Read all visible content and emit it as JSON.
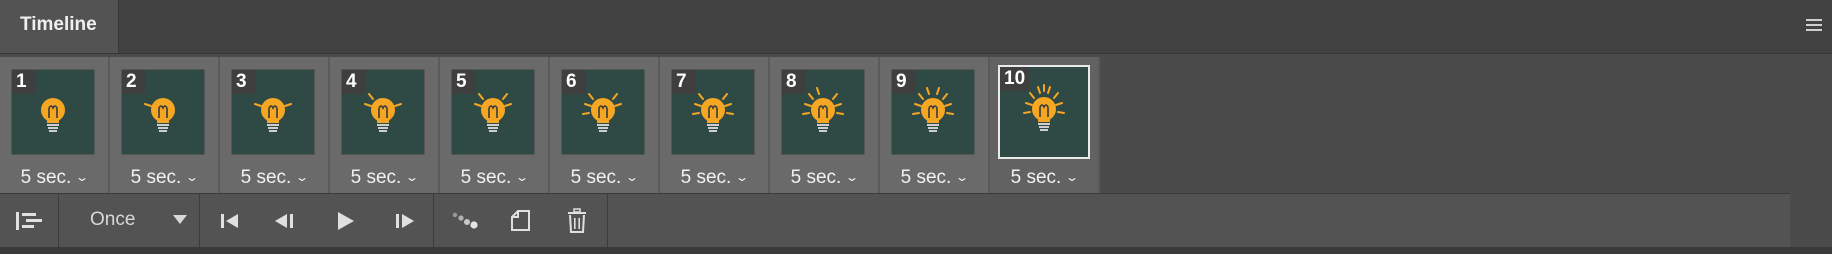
{
  "panel": {
    "title": "Timeline",
    "menu_icon": "panel-menu-icon"
  },
  "frames": [
    {
      "number": "1",
      "delay": "5 sec.",
      "selected": false,
      "rays": 0
    },
    {
      "number": "2",
      "delay": "5 sec.",
      "selected": false,
      "rays": 1
    },
    {
      "number": "3",
      "delay": "5 sec.",
      "selected": false,
      "rays": 2
    },
    {
      "number": "4",
      "delay": "5 sec.",
      "selected": false,
      "rays": 3
    },
    {
      "number": "5",
      "delay": "5 sec.",
      "selected": false,
      "rays": 4
    },
    {
      "number": "6",
      "delay": "5 sec.",
      "selected": false,
      "rays": 5
    },
    {
      "number": "7",
      "delay": "5 sec.",
      "selected": false,
      "rays": 6
    },
    {
      "number": "8",
      "delay": "5 sec.",
      "selected": false,
      "rays": 7
    },
    {
      "number": "9",
      "delay": "5 sec.",
      "selected": false,
      "rays": 8
    },
    {
      "number": "10",
      "delay": "5 sec.",
      "selected": true,
      "rays": 9
    }
  ],
  "toolbar": {
    "loop_option": "Once",
    "icons": [
      "convert-to-video-timeline-icon",
      "first-frame-icon",
      "previous-frame-icon",
      "play-icon",
      "next-frame-icon",
      "tween-icon",
      "duplicate-frame-icon",
      "delete-frame-icon"
    ]
  },
  "colors": {
    "thumb_bg": "#2f4a45",
    "bulb": "#f5a623",
    "rays": "#f5a623"
  }
}
